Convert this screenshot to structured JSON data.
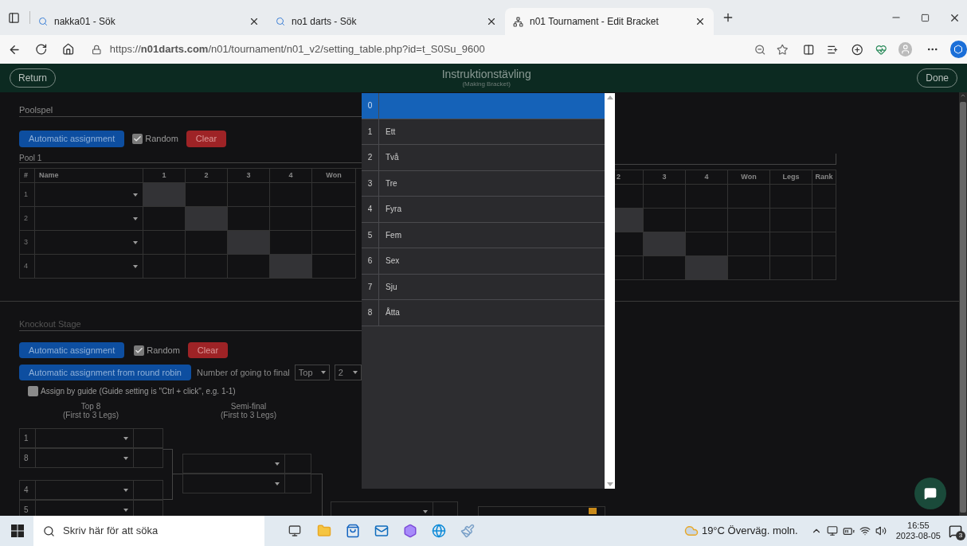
{
  "browser": {
    "tabs": [
      {
        "title": "nakka01 - Sök",
        "selected": false
      },
      {
        "title": "no1 darts - Sök",
        "selected": false
      },
      {
        "title": "n01 Tournament - Edit Bracket",
        "selected": true
      }
    ],
    "url": "https://**n01darts.com**/n01/tournament/n01_v2/setting_table.php?id=t_S0Su_9600"
  },
  "header": {
    "return": "Return",
    "title": "Instruktionstävling",
    "subtitle": "(Making Bracket)",
    "done": "Done"
  },
  "pool_section": {
    "title": "Poolspel",
    "auto_button": "Automatic assignment",
    "random": {
      "label": "Random",
      "checked": true
    },
    "clear": "Clear"
  },
  "pool1": {
    "title": "Pool 1",
    "columns": [
      "#",
      "Name",
      "1",
      "2",
      "3",
      "4",
      "Won"
    ],
    "rows": [
      {
        "number": "1"
      },
      {
        "number": "2"
      },
      {
        "number": "3"
      },
      {
        "number": "4"
      }
    ]
  },
  "pool2": {
    "columns": [
      "2",
      "3",
      "4",
      "Won",
      "Legs",
      "Rank"
    ]
  },
  "knockout": {
    "title": "Knockout Stage",
    "auto_button": "Automatic assignment",
    "random": {
      "label": "Random",
      "checked": true
    },
    "clear": "Clear",
    "round_robin_button": "Automatic assignment from round robin",
    "final_label": "Number of going to final",
    "final_selects": [
      "Top",
      "2"
    ],
    "guide": {
      "label": "Assign by guide (Guide setting is \"Ctrl + click\", e.g. 1-1)",
      "checked": false
    },
    "top8": {
      "title": "Top 8",
      "subtitle": "(First to 3 Legs)",
      "seeds": [
        "1",
        "8",
        "4",
        "5"
      ]
    },
    "semi": {
      "title": "Semi-final",
      "subtitle": "(First to 3 Legs)"
    }
  },
  "dropdown": {
    "options": [
      {
        "number": "0",
        "selected": true
      },
      {
        "number": "1",
        "label": "Ett",
        "selected": false
      },
      {
        "number": "2",
        "label": "Två",
        "selected": false
      },
      {
        "number": "3",
        "label": "Tre",
        "selected": false
      },
      {
        "number": "4",
        "label": "Fyra",
        "selected": false
      },
      {
        "number": "5",
        "label": "Fem",
        "selected": false
      },
      {
        "number": "6",
        "label": "Sex",
        "selected": false
      },
      {
        "number": "7",
        "label": "Sju",
        "selected": false
      },
      {
        "number": "8",
        "label": "Åtta",
        "selected": false
      }
    ]
  },
  "taskbar": {
    "search_placeholder": "Skriv här för att söka",
    "weather": "19°C Överväg. moln.",
    "time": "16:55",
    "date": "2023-08-05",
    "notifications": "3"
  }
}
